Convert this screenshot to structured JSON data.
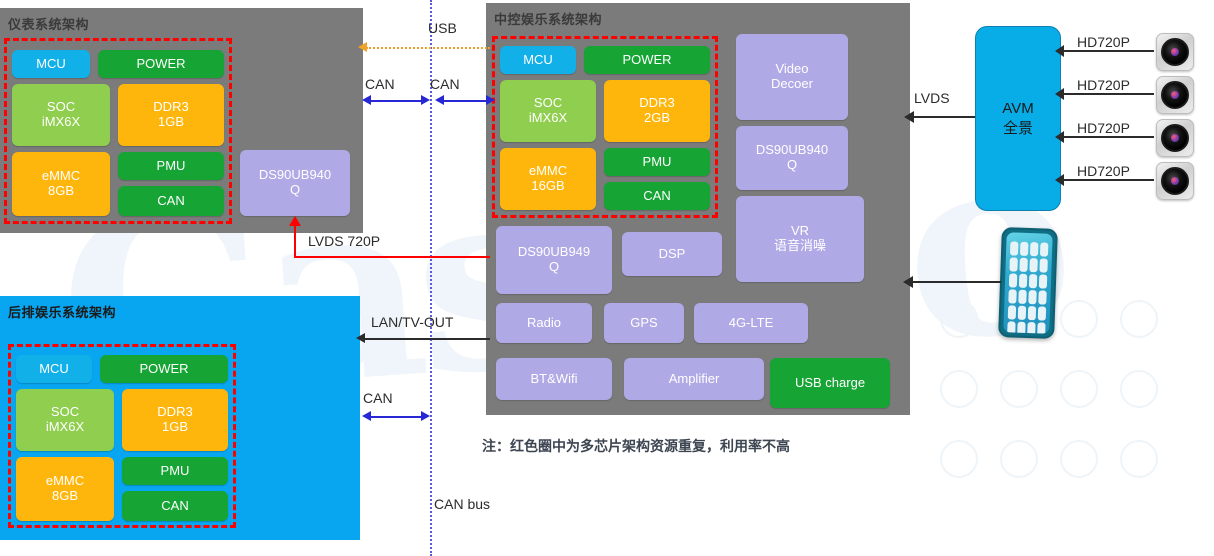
{
  "panels": {
    "cluster": {
      "title": "仪表系统架构"
    },
    "headunit": {
      "title": "中控娱乐系统架构"
    },
    "rear": {
      "title": "后排娱乐系统架构"
    }
  },
  "cluster_blocks": [
    {
      "label": "MCU"
    },
    {
      "label": "POWER"
    },
    {
      "label": "SOC",
      "sub": "iMX6X"
    },
    {
      "label": "DDR3",
      "sub": "1GB"
    },
    {
      "label": "eMMC",
      "sub": "8GB"
    },
    {
      "label": "PMU"
    },
    {
      "label": "CAN"
    }
  ],
  "cluster_extra": [
    {
      "label": "DS90UB940",
      "sub": "Q"
    }
  ],
  "headunit_core_blocks": [
    {
      "label": "MCU"
    },
    {
      "label": "POWER"
    },
    {
      "label": "SOC",
      "sub": "iMX6X"
    },
    {
      "label": "DDR3",
      "sub": "2GB"
    },
    {
      "label": "eMMC",
      "sub": "16GB"
    },
    {
      "label": "PMU"
    },
    {
      "label": "CAN"
    }
  ],
  "headunit_right_blocks": [
    {
      "label": "Video",
      "sub": "Decoer"
    },
    {
      "label": "DS90UB940",
      "sub": "Q"
    },
    {
      "label": "VR",
      "sub": "语音消噪"
    }
  ],
  "headunit_lower_blocks": [
    {
      "label": "DS90UB949",
      "sub": "Q"
    },
    {
      "label": "DSP"
    },
    {
      "label": "Radio"
    },
    {
      "label": "GPS"
    },
    {
      "label": "4G-LTE"
    },
    {
      "label": "BT&Wifi"
    },
    {
      "label": "Amplifier"
    },
    {
      "label": "USB charge"
    }
  ],
  "rear_blocks": [
    {
      "label": "MCU"
    },
    {
      "label": "POWER"
    },
    {
      "label": "SOC",
      "sub": "iMX6X"
    },
    {
      "label": "DDR3",
      "sub": "1GB"
    },
    {
      "label": "eMMC",
      "sub": "8GB"
    },
    {
      "label": "PMU"
    },
    {
      "label": "CAN"
    }
  ],
  "avm": {
    "label": "AVM",
    "sub": "全景"
  },
  "connections": {
    "usb": "USB",
    "can_left": "CAN",
    "can_right": "CAN",
    "lvds_720p": "LVDS 720P",
    "lan_tv_out": "LAN/TV-OUT",
    "can_rear": "CAN",
    "can_bus": "CAN bus",
    "lvds": "LVDS"
  },
  "cameras": [
    {
      "label": "HD720P"
    },
    {
      "label": "HD720P"
    },
    {
      "label": "HD720P"
    },
    {
      "label": "HD720P"
    }
  ],
  "note": "注：红色圈中为多芯片架构资源重复，利用率不高",
  "watermark": {
    "text": "GasGoo"
  },
  "colors": {
    "panel_grey": "#7b7b7b",
    "panel_blue": "#08a5f0",
    "mcu": "#12b0e8",
    "green": "#16a434",
    "soc": "#8fce4e",
    "orange": "#ffb60c",
    "purple": "#afa9e6",
    "red_dash": "#ff0000",
    "can_blue": "#2727d6",
    "usb_orange": "#f0a32a",
    "avm": "#08ade8"
  }
}
